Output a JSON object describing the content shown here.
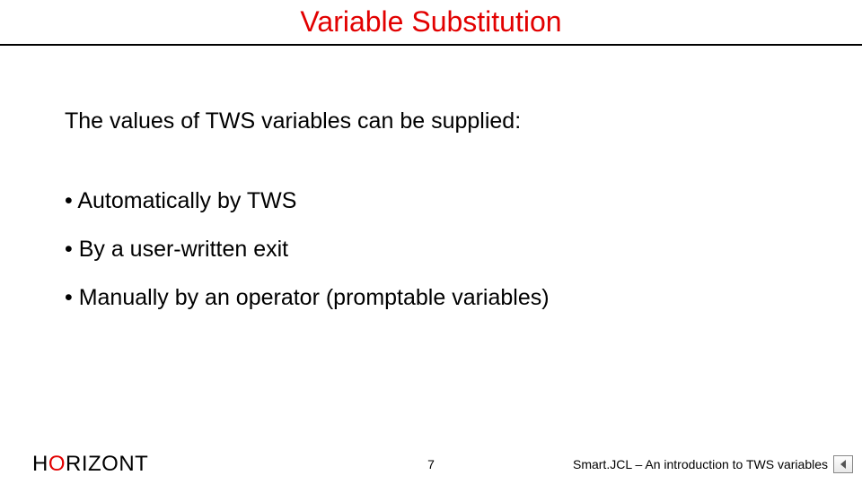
{
  "title": "Variable Substitution",
  "intro": "The values of TWS variables can be supplied:",
  "bullets": [
    "Automatically by TWS",
    "By a user-written exit",
    "Manually by an operator (promptable variables)"
  ],
  "footer": {
    "logo_pre": "H",
    "logo_accent": "O",
    "logo_post": "RIZONT",
    "page": "7",
    "subtitle": "Smart.JCL – An introduction to TWS variables"
  }
}
